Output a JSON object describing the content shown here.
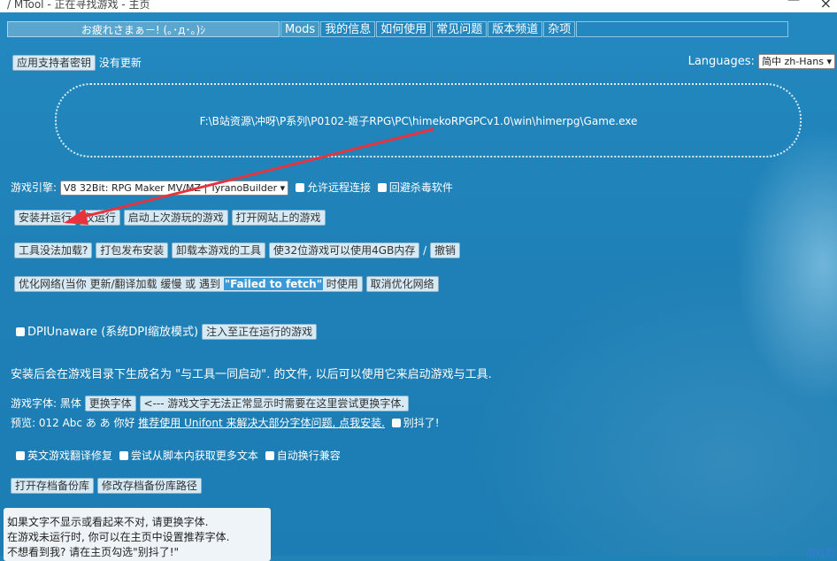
{
  "window": {
    "title": "/  MTool - 正在寻找游戏 - 主页",
    "min_glyph": "—",
    "close_glyph": "×"
  },
  "tabs": [
    {
      "label": "お疲れさまぁ－! (｡･д･｡)ｼ"
    },
    {
      "label": "Mods"
    },
    {
      "label": "我的信息"
    },
    {
      "label": "如何使用"
    },
    {
      "label": "常见问题"
    },
    {
      "label": "版本频道"
    },
    {
      "label": "杂项"
    }
  ],
  "header": {
    "supporter_key_button": "应用支持者密钥",
    "update_status": "没有更新",
    "languages_label": "Languages:",
    "language_selected": "简中 zh-Hans"
  },
  "dropzone": {
    "path": "F:\\B站资源\\冲呀\\P系列\\P0102-姬子RPG\\PC\\himekoRPGPCv1.0\\win\\himerpg\\Game.exe"
  },
  "engine": {
    "label": "游戏引擎:",
    "selected": "V8 32Bit: RPG Maker MV/MZ | TyranoBuilder",
    "allow_remote": "允许远程连接",
    "avoid_av": "回避杀毒软件"
  },
  "run_buttons": [
    "安装并运行",
    "仅运行",
    "启动上次游玩的游戏",
    "打开网站上的游戏"
  ],
  "tool_buttons": {
    "not_loaded": "工具没法加载?",
    "pack_install": "打包发布安装",
    "uninstall_tools": "卸载本游戏的工具",
    "use_4gb": "使32位游戏可以使用4GB内存",
    "separator": "/",
    "undo": "撤销"
  },
  "network": {
    "optimize_prefix": "优化网络(当你 更新/翻译加载 缓慢 或 遇到 ",
    "optimize_highlight": "\"Failed to fetch\"",
    "optimize_suffix": " 时使用",
    "cancel": "取消优化网络"
  },
  "dpi": {
    "checkbox_label": "DPIUnaware (系统DPI缩放模式)",
    "inject_button": "注入至正在运行的游戏"
  },
  "install_note": "安装后会在游戏目录下生成名为 \"与工具一同启动\". 的文件, 以后可以使用它来启动游戏与工具.",
  "font": {
    "label": "游戏字体: 黑体",
    "change_button": "更换字体",
    "hint_button": "<--- 游戏文字无法正常显示时需要在这里尝试更换字体.",
    "preview_label": "预览: 012  Abc  あ あ  你好",
    "unifont_link": "推荐使用 Unifont 来解决大部分字体问题, 点我安装.",
    "dont_shake": "别抖了!"
  },
  "options": {
    "english_fix": "英文游戏翻译修复",
    "more_text": "尝试从脚本内获取更多文本",
    "auto_wrap": "自动换行兼容"
  },
  "backup": {
    "open": "打开存档备份库",
    "change_path": "修改存档备份库路径"
  },
  "tooltip": {
    "line1": "如果文字不显示或看起来不对, 请更换字体.",
    "line2": "在游戏未运行时, 你可以在主页中设置推荐字体.",
    "line3": "不想看到我? 请在主页勾选\"别抖了!\""
  },
  "corner_text": "游戏页"
}
